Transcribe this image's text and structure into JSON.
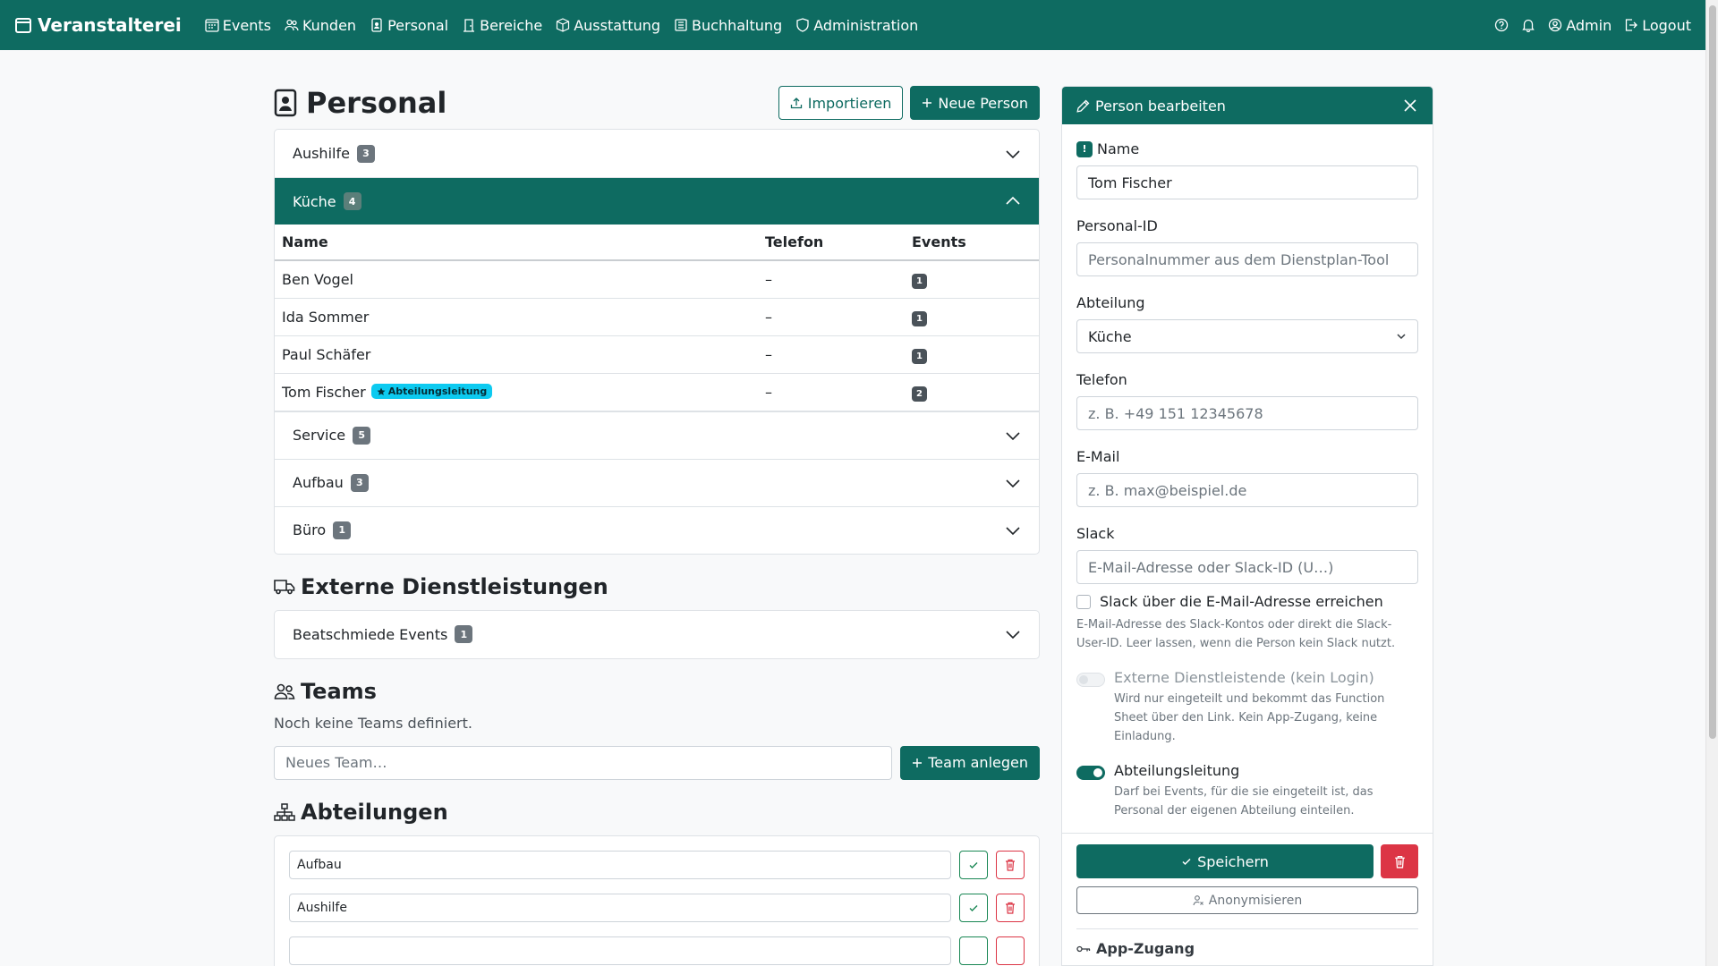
{
  "nav": {
    "brand": "Veranstalterei",
    "items": [
      "Events",
      "Kunden",
      "Personal",
      "Bereiche",
      "Ausstattung",
      "Buchhaltung",
      "Administration"
    ],
    "admin": "Admin",
    "logout": "Logout"
  },
  "page": {
    "title": "Personal",
    "import_label": "Importieren",
    "new_person_label": "Neue Person"
  },
  "groups": [
    {
      "name": "Aushilfe",
      "count": "3",
      "open": false
    },
    {
      "name": "Küche",
      "count": "4",
      "open": true
    },
    {
      "name": "Service",
      "count": "5",
      "open": false
    },
    {
      "name": "Aufbau",
      "count": "3",
      "open": false
    },
    {
      "name": "Büro",
      "count": "1",
      "open": false
    }
  ],
  "table": {
    "headers": [
      "Name",
      "Telefon",
      "Events"
    ],
    "rows": [
      {
        "name": "Ben Vogel",
        "phone": "–",
        "events": "1",
        "lead": ""
      },
      {
        "name": "Ida Sommer",
        "phone": "–",
        "events": "1",
        "lead": ""
      },
      {
        "name": "Paul Schäfer",
        "phone": "–",
        "events": "1",
        "lead": ""
      },
      {
        "name": "Tom Fischer",
        "phone": "–",
        "events": "2",
        "lead": "Abteilungsleitung"
      }
    ]
  },
  "external": {
    "title": "Externe Dienstleistungen",
    "groups": [
      {
        "name": "Beatschmiede Events",
        "count": "1"
      }
    ]
  },
  "teams": {
    "title": "Teams",
    "empty": "Noch keine Teams definiert.",
    "placeholder": "Neues Team…",
    "button": "Team anlegen"
  },
  "departments": {
    "title": "Abteilungen",
    "items": [
      "Aufbau",
      "Aushilfe"
    ]
  },
  "panel": {
    "title": "Person bearbeiten",
    "name_label": "Name",
    "required_mark": "!",
    "name_value": "Tom Fischer",
    "id_label": "Personal-ID",
    "id_placeholder": "Personalnummer aus dem Dienstplan-Tool",
    "dept_label": "Abteilung",
    "dept_value": "Küche",
    "phone_label": "Telefon",
    "phone_placeholder": "z. B. +49 151 12345678",
    "email_label": "E-Mail",
    "email_placeholder": "z. B. max@beispiel.de",
    "slack_label": "Slack",
    "slack_placeholder": "E-Mail-Adresse oder Slack-ID (U…)",
    "slack_check": "Slack über die E-Mail-Adresse erreichen",
    "slack_help": "E-Mail-Adresse des Slack-Kontos oder direkt die Slack-User-ID. Leer lassen, wenn die Person kein Slack nutzt.",
    "external_label": "Externe Dienstleistende (kein Login)",
    "external_help": "Wird nur eingeteilt und bekommt das Function Sheet über den Link. Kein App-Zugang, keine Einladung.",
    "lead_label": "Abteilungsleitung",
    "lead_help": "Darf bei Events, für die sie eingeteilt ist, das Personal der eigenen Abteilung einteilen.",
    "save": "Speichern",
    "anonymize": "Anonymisieren",
    "app_access": "App-Zugang"
  },
  "colors": {
    "primary": "#0e6b61",
    "danger": "#dc3545",
    "info": "#0dcaf0"
  }
}
